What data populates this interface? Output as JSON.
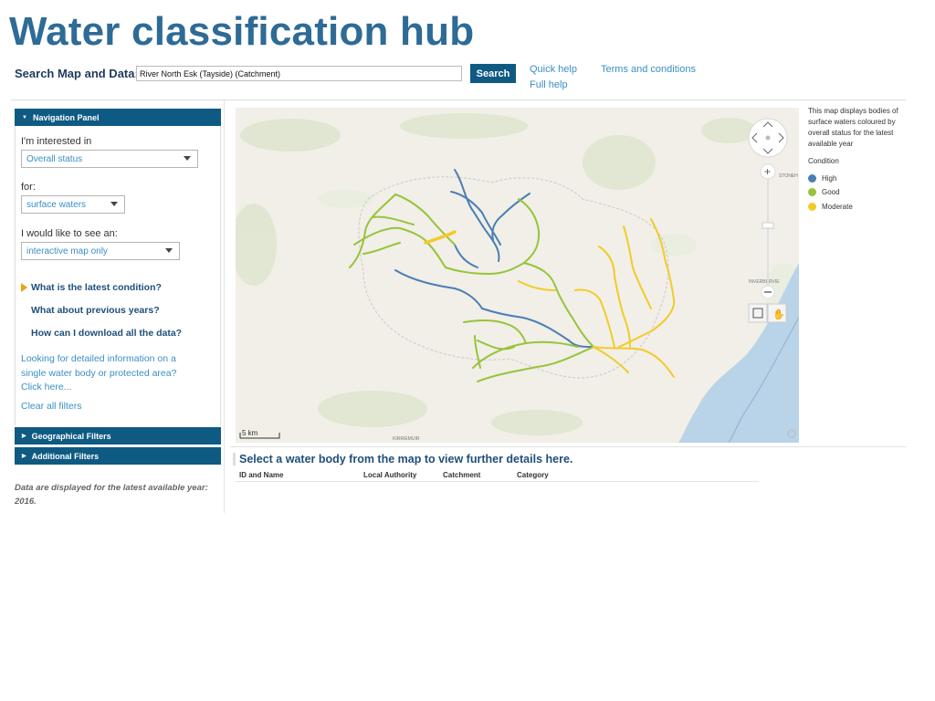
{
  "header": {
    "title": "Water classification hub",
    "search_label": "Search Map and Data:",
    "search_value": "River North Esk (Tayside) (Catchment)",
    "search_button": "Search",
    "quick_help": "Quick help",
    "full_help": "Full help",
    "terms": "Terms and conditions"
  },
  "nav_panel": {
    "title": "Navigation Panel",
    "interested_label": "I'm interested in",
    "interested_value": "Overall status",
    "for_label": "for:",
    "for_value": "surface waters",
    "see_label": "I would like to see an:",
    "see_value": "interactive map only",
    "q1": "What is the latest condition?",
    "q2": "What about previous years?",
    "q3": "How can I download all the data?",
    "detail_line1": "Looking for detailed information on a",
    "detail_line2": "single water body or protected area?",
    "detail_line3": "Click here...",
    "clear": "Clear all filters",
    "geo_filters": "Geographical Filters",
    "additional_filters": "Additional Filters"
  },
  "data_note_line1": "Data are displayed for the latest available year:",
  "data_note_line2": "2016.",
  "map": {
    "scale": "5 km",
    "town1": "KIRRIEMUIR",
    "town2": "STONEH",
    "town3": "INVERBERVIE",
    "colors": {
      "high": "#4a7fb5",
      "good": "#98c33c",
      "moderate": "#f2cb2a",
      "land": "#f1efe7",
      "sea": "#b9d3e8"
    }
  },
  "legend": {
    "line1": "This map displays bodies of",
    "line2": "surface waters coloured by",
    "line3": "overall status for the latest",
    "line4": "available year",
    "title": "Condition",
    "items": [
      {
        "label": "High",
        "color": "#4a7fb5"
      },
      {
        "label": "Good",
        "color": "#98c33c"
      },
      {
        "label": "Moderate",
        "color": "#f2cb2a"
      }
    ]
  },
  "details": {
    "message": "Select a water body from the map to view further details here.",
    "columns": [
      "ID and Name",
      "Local Authority",
      "Catchment",
      "Category"
    ]
  }
}
